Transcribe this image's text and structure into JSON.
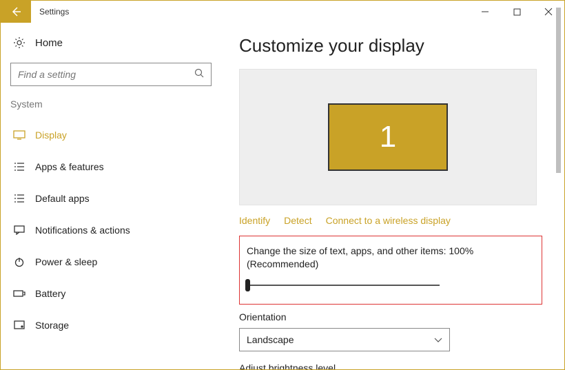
{
  "titlebar": {
    "title": "Settings"
  },
  "sidebar": {
    "home_label": "Home",
    "search_placeholder": "Find a setting",
    "category": "System",
    "items": [
      {
        "label": "Display",
        "active": true
      },
      {
        "label": "Apps & features"
      },
      {
        "label": "Default apps"
      },
      {
        "label": "Notifications & actions"
      },
      {
        "label": "Power & sleep"
      },
      {
        "label": "Battery"
      },
      {
        "label": "Storage"
      }
    ]
  },
  "main": {
    "page_title": "Customize your display",
    "monitor_number": "1",
    "links": {
      "identify": "Identify",
      "detect": "Detect",
      "wireless": "Connect to a wireless display"
    },
    "scale_text": "Change the size of text, apps, and other items: 100% (Recommended)",
    "orientation_label": "Orientation",
    "orientation_value": "Landscape",
    "brightness_label": "Adjust brightness level"
  }
}
